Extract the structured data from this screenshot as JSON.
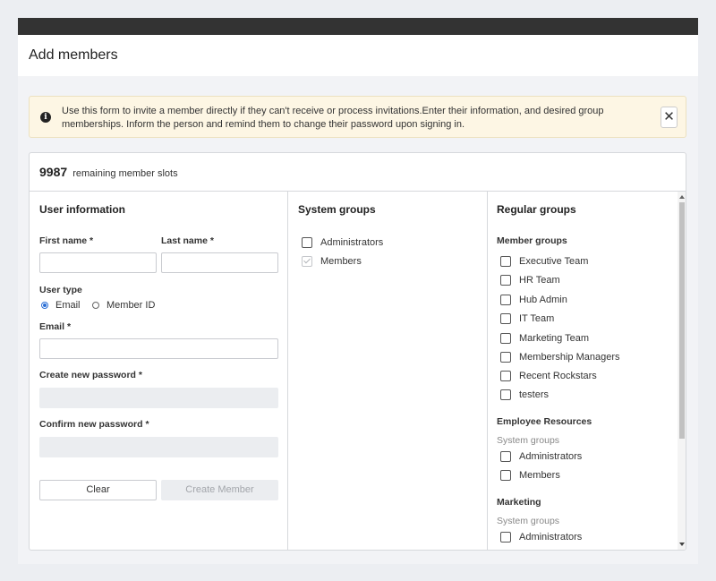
{
  "page": {
    "title": "Add members"
  },
  "alert": {
    "message": "Use this form to invite a member directly if they can't receive or process invitations.Enter their information, and desired group memberships. Inform the person and remind them to change their password upon signing in.",
    "close_glyph": "✕",
    "info_glyph": "i"
  },
  "slots": {
    "count": "9987",
    "label": "remaining member slots"
  },
  "user_info": {
    "title": "User information",
    "first_name_label": "First name",
    "last_name_label": "Last name",
    "required_mark": "*",
    "user_type_label": "User type",
    "user_type_options": [
      "Email",
      "Member ID"
    ],
    "user_type_selected": "Email",
    "email_label": "Email",
    "create_password_label": "Create new password",
    "confirm_password_label": "Confirm new password",
    "clear_button": "Clear",
    "create_button": "Create Member"
  },
  "system_groups": {
    "title": "System groups",
    "items": [
      {
        "label": "Administrators",
        "checked": false,
        "disabled": false
      },
      {
        "label": "Members",
        "checked": true,
        "disabled": true
      }
    ]
  },
  "regular_groups": {
    "title": "Regular groups",
    "member_groups_heading": "Member groups",
    "member_groups": [
      "Executive Team",
      "HR Team",
      "Hub Admin",
      "IT Team",
      "Marketing Team",
      "Membership Managers",
      "Recent Rockstars",
      "testers"
    ],
    "sections": [
      {
        "heading": "Employee Resources",
        "subheading": "System groups",
        "items": [
          "Administrators",
          "Members"
        ]
      },
      {
        "heading": "Marketing",
        "subheading": "System groups",
        "items": [
          "Administrators"
        ]
      }
    ]
  }
}
